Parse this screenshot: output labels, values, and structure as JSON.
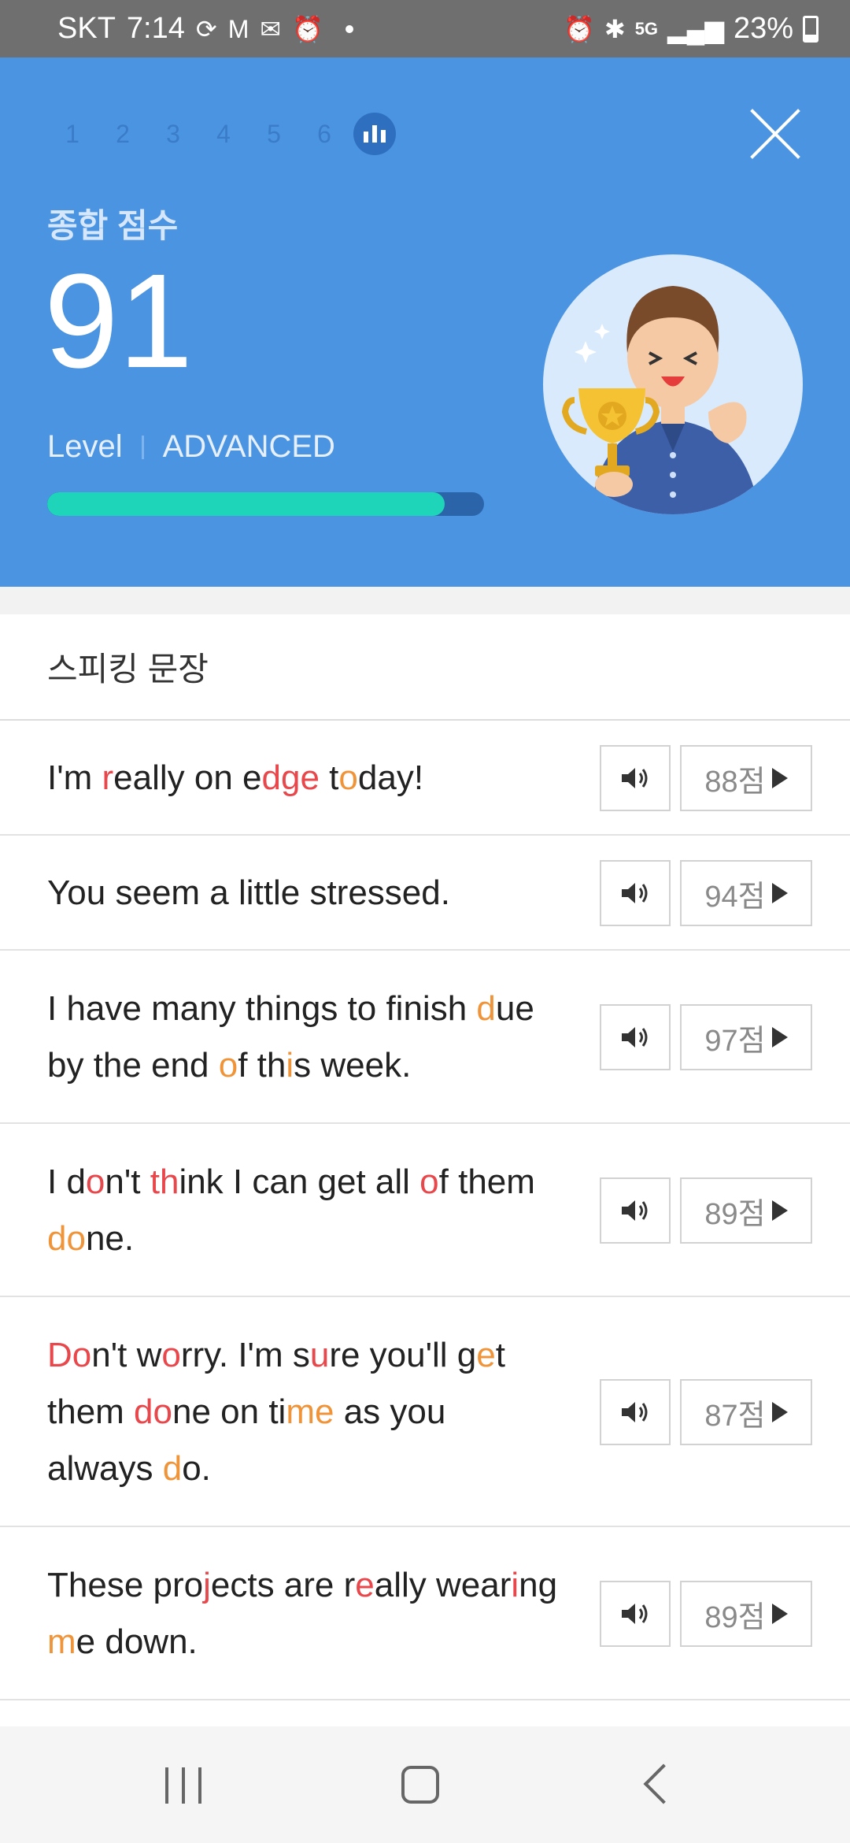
{
  "status_bar": {
    "carrier": "SKT",
    "time": "7:14",
    "battery": "23%",
    "network": "5G"
  },
  "header": {
    "steps": [
      "1",
      "2",
      "3",
      "4",
      "5",
      "6"
    ],
    "active_step_icon": "bar-chart-icon",
    "score_label": "종합 점수",
    "score": "91",
    "level_label": "Level",
    "level_value": "ADVANCED",
    "level_progress": 0.91,
    "colors": {
      "header_bg": "#4a94e2",
      "progress_fill": "#1ed4b9"
    }
  },
  "list": {
    "title": "스피킹 문장",
    "highlight_colors": {
      "red": "#e8474b",
      "orange": "#f0943a"
    },
    "sentences": [
      {
        "text": "I'm really on edge today!",
        "score": "88점"
      },
      {
        "text": "You seem a little stressed.",
        "score": "94점"
      },
      {
        "text": "I have many things to finish due by the end of this week.",
        "score": "97점"
      },
      {
        "text": "I don't think I can get all of them done.",
        "score": "89점"
      },
      {
        "text": "Don't worry. I'm sure you'll get them done on time as you always do.",
        "score": "87점"
      },
      {
        "text": "These projects are really wearing me down.",
        "score": "89점"
      }
    ]
  },
  "nav": {
    "icons": [
      "recent-apps-icon",
      "home-icon",
      "back-icon"
    ]
  }
}
